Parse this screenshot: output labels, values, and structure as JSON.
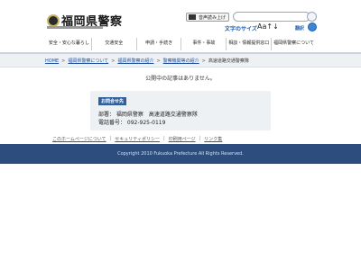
{
  "header": {
    "logo_text": "福岡県警察",
    "voice_button": "音声読み上げ",
    "text_size_label": "文字のサイズ",
    "text_size_aa": "Aa↑↓",
    "translate_label": "翻訳"
  },
  "gnav": [
    "安全・安心な暮らし",
    "交通安全",
    "申請・手続き",
    "事件・事故",
    "相談・情報提供窓口",
    "福岡県警察について"
  ],
  "breadcrumb": {
    "home": "HOME",
    "items": [
      "福岡県警察について",
      "福岡県警察の紹介",
      "警察機関等の紹介"
    ],
    "current": "高速道路交通警察隊"
  },
  "notice": "公開中の記事はありません。",
  "contact": {
    "tag": "お問合せ先",
    "dept": "部署：  福岡県警察　高速道路交通警察隊",
    "phone": "電話番号：  092-925-0119"
  },
  "footer": {
    "links": [
      "このホームページについて",
      "セキュリティポリシー",
      "印刷用ページ",
      "リンク集"
    ],
    "copyright": "Copyright 2010 Fukuoka Prefecture All Rights Reserved."
  }
}
